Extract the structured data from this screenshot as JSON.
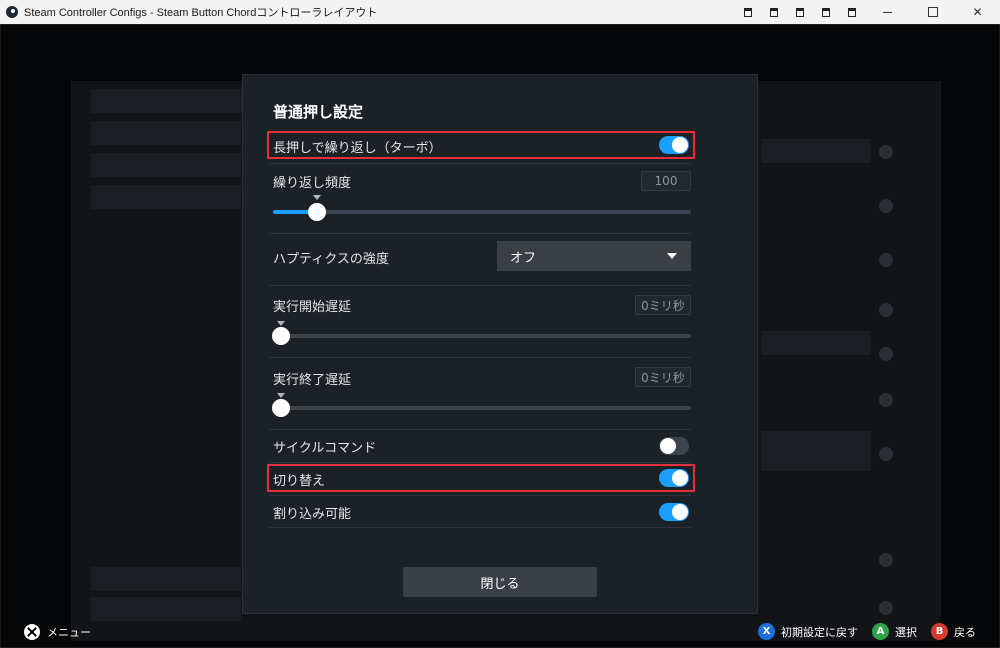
{
  "window": {
    "title": "Steam Controller Configs - Steam Button Chordコントローラレイアウト",
    "close_glyph": "✕"
  },
  "dialog": {
    "title": "普通押し設定",
    "turbo": {
      "label": "長押しで繰り返し（ターボ）",
      "enabled": true
    },
    "repeat_rate": {
      "label": "繰り返し頻度",
      "value": "100",
      "slider_fraction": 0.11
    },
    "haptics": {
      "label": "ハプティクスの強度",
      "selected": "オフ"
    },
    "start_delay": {
      "label": "実行開始遅延",
      "value": "0ミリ秒",
      "slider_fraction": 0.0
    },
    "end_delay": {
      "label": "実行終了遅延",
      "value": "0ミリ秒",
      "slider_fraction": 0.0
    },
    "cycle_command": {
      "label": "サイクルコマンド",
      "enabled": false
    },
    "toggle": {
      "label": "切り替え",
      "enabled": true
    },
    "interruptible": {
      "label": "割り込み可能",
      "enabled": true
    },
    "close_label": "閉じる"
  },
  "footer": {
    "menu_label": "メニュー",
    "actions": [
      {
        "button": "X",
        "label": "初期設定に戻す"
      },
      {
        "button": "A",
        "label": "選択"
      },
      {
        "button": "B",
        "label": "戻る"
      }
    ]
  },
  "colors": {
    "accent": "#1a9fff",
    "highlight": "#e3303a",
    "dialog_bg": "#1c2128"
  }
}
